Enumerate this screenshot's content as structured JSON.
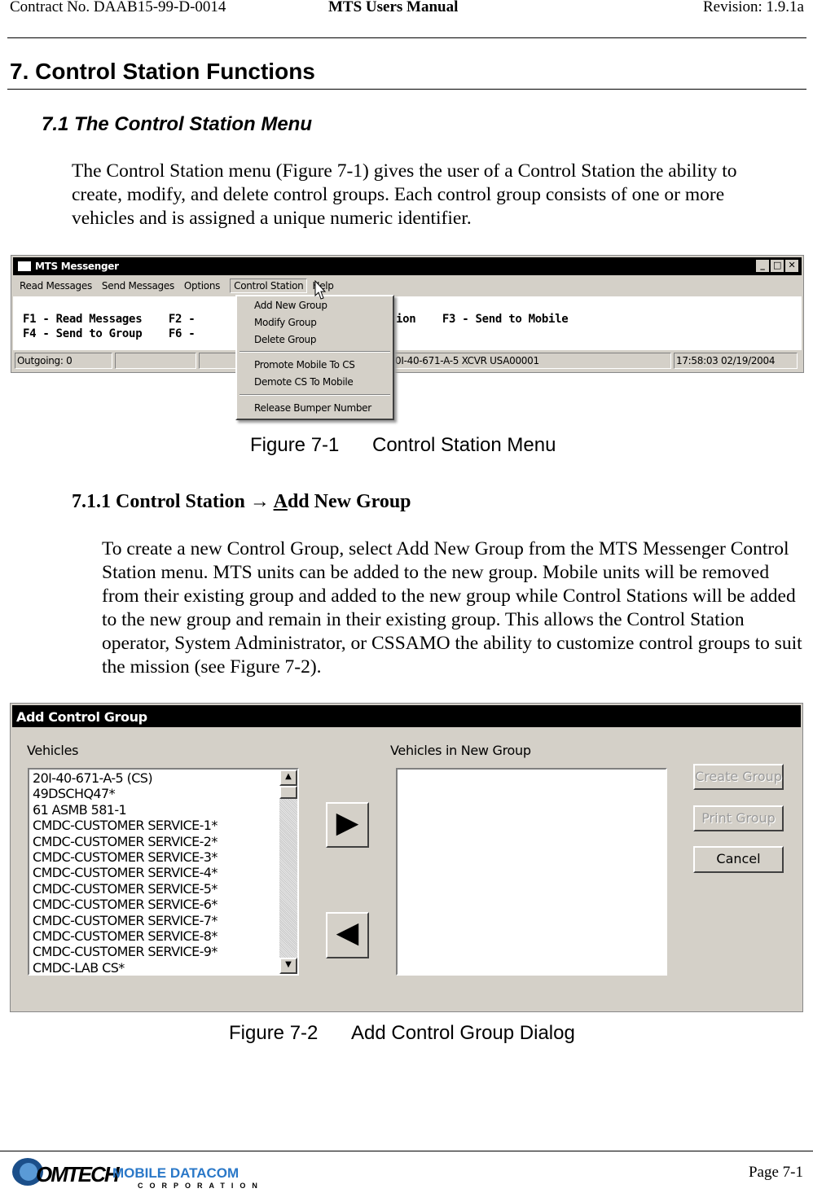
{
  "header": {
    "contract": "Contract No. DAAB15-99-D-0014",
    "title": "MTS Users Manual",
    "revision": "Revision:  1.9.1a"
  },
  "section": {
    "heading": "7.  Control Station Functions",
    "sub": "7.1  The Control Station Menu",
    "para": "The Control Station menu (Figure 7-1) gives the user of a Control Station the ability to create, modify, and delete control groups. Each control group consists of one or more vehicles and is assigned a unique numeric identifier."
  },
  "fig1": {
    "window_title": "MTS Messenger",
    "menu": [
      "Read Messages",
      "Send Messages",
      "Options",
      "Control Station",
      "Help"
    ],
    "line1": "F1 - Read Messages    F2 - ",
    "line1b": "ion    F3 - Send to Mobile",
    "line2": "F4 - Send to Group    F6 - ",
    "status": {
      "outgoing": "Outgoing: 0",
      "unit": "0I-40-671-A-5  XCVR USA00001",
      "time": "17:58:03 02/19/2004"
    },
    "dropdown": [
      "Add New Group",
      "Modify Group",
      "Delete Group",
      "Promote Mobile To CS",
      "Demote CS To Mobile",
      "Release Bumper Number"
    ],
    "caption_num": "Figure 7-1",
    "caption": "Control Station Menu"
  },
  "sub2": {
    "heading_pre": "7.1.1  Control Station ",
    "arrow": "→",
    "heading_A": "A",
    "heading_post": "dd New Group",
    "para": "To create a new Control Group, select Add New Group from the MTS Messenger Control Station menu.  MTS units can be added to the new group.  Mobile units will be removed from their existing group and added to the new group while Control Stations will be added to the new group and remain in their existing group.  This allows the Control Station operator, System Administrator, or CSSAMO the ability to customize control groups to suit the mission (see Figure 7-2)."
  },
  "fig2": {
    "window_title": "Add Control Group",
    "vehicles_label": "Vehicles",
    "new_group_label": "Vehicles in New Group",
    "vehicles": [
      "20I-40-671-A-5 (CS)",
      "49DSCHQ47*",
      "61 ASMB 581-1",
      "CMDC-CUSTOMER SERVICE-1*",
      "CMDC-CUSTOMER SERVICE-2*",
      "CMDC-CUSTOMER SERVICE-3*",
      "CMDC-CUSTOMER SERVICE-4*",
      "CMDC-CUSTOMER SERVICE-5*",
      "CMDC-CUSTOMER SERVICE-6*",
      "CMDC-CUSTOMER SERVICE-7*",
      "CMDC-CUSTOMER SERVICE-8*",
      "CMDC-CUSTOMER SERVICE-9*",
      "CMDC-LAB CS*"
    ],
    "buttons": {
      "create": "Create Group",
      "print": "Print Group",
      "cancel": "Cancel"
    },
    "caption_num": "Figure 7-2",
    "caption": "Add Control Group Dialog"
  },
  "footer": {
    "logo": "COMTECH MOBILE DATACOM CORPORATION",
    "page": "Page 7-1"
  }
}
